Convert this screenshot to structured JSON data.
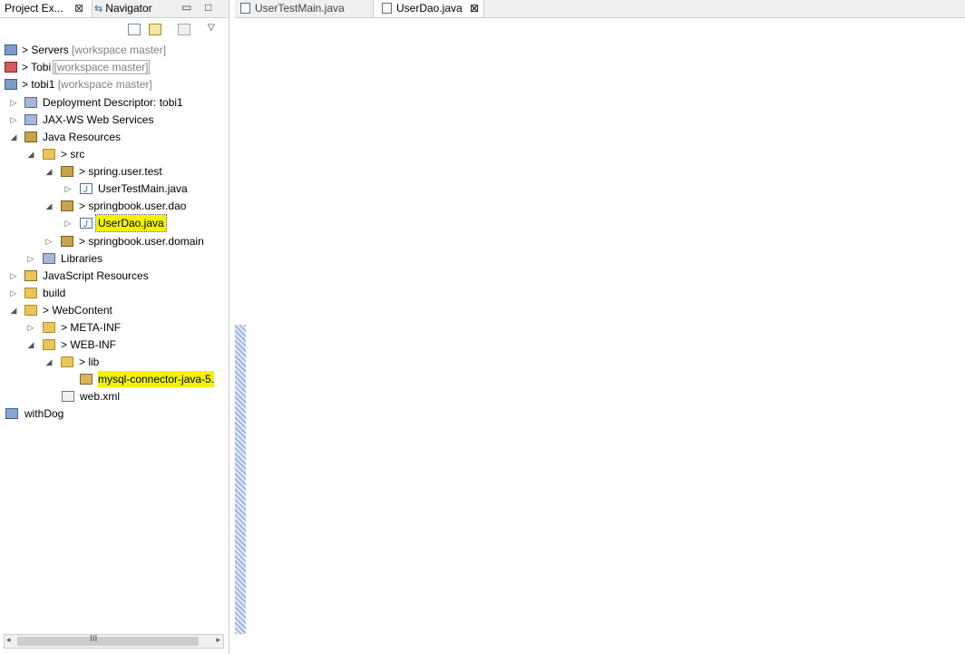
{
  "left_panel": {
    "tabs": {
      "project_explorer": "Project Ex...",
      "navigator": "Navigator"
    },
    "tree": [
      {
        "label": "Servers",
        "decoration": "[workspace master]",
        "prefix": "> "
      },
      {
        "label": "Tobi",
        "decoration": "[workspace master]",
        "prefix": "> "
      },
      {
        "label": "tobi1",
        "decoration": "[workspace master]",
        "prefix": "> "
      },
      {
        "label": "Deployment Descriptor: tobi1"
      },
      {
        "label": "JAX-WS Web Services"
      },
      {
        "label": "Java Resources"
      },
      {
        "label": "src",
        "prefix": "> "
      },
      {
        "label": "spring.user.test",
        "prefix": "> "
      },
      {
        "label": "UserTestMain.java",
        "prefix": "> "
      },
      {
        "label": "springbook.user.dao",
        "prefix": "> "
      },
      {
        "label": "UserDao.java",
        "prefix": "> "
      },
      {
        "label": "springbook.user.domain",
        "prefix": "> "
      },
      {
        "label": "Libraries"
      },
      {
        "label": "JavaScript Resources"
      },
      {
        "label": "build"
      },
      {
        "label": "WebContent",
        "prefix": "> "
      },
      {
        "label": "META-INF",
        "prefix": "> "
      },
      {
        "label": "WEB-INF",
        "prefix": "> "
      },
      {
        "label": "lib",
        "prefix": "> "
      },
      {
        "label": "mysql-connector-java-5."
      },
      {
        "label": "web.xml"
      },
      {
        "label": "withDog"
      }
    ],
    "scroll_grip": "III"
  },
  "editor": {
    "tabs": [
      "UserTestMain.java",
      "UserDao.java"
    ]
  }
}
